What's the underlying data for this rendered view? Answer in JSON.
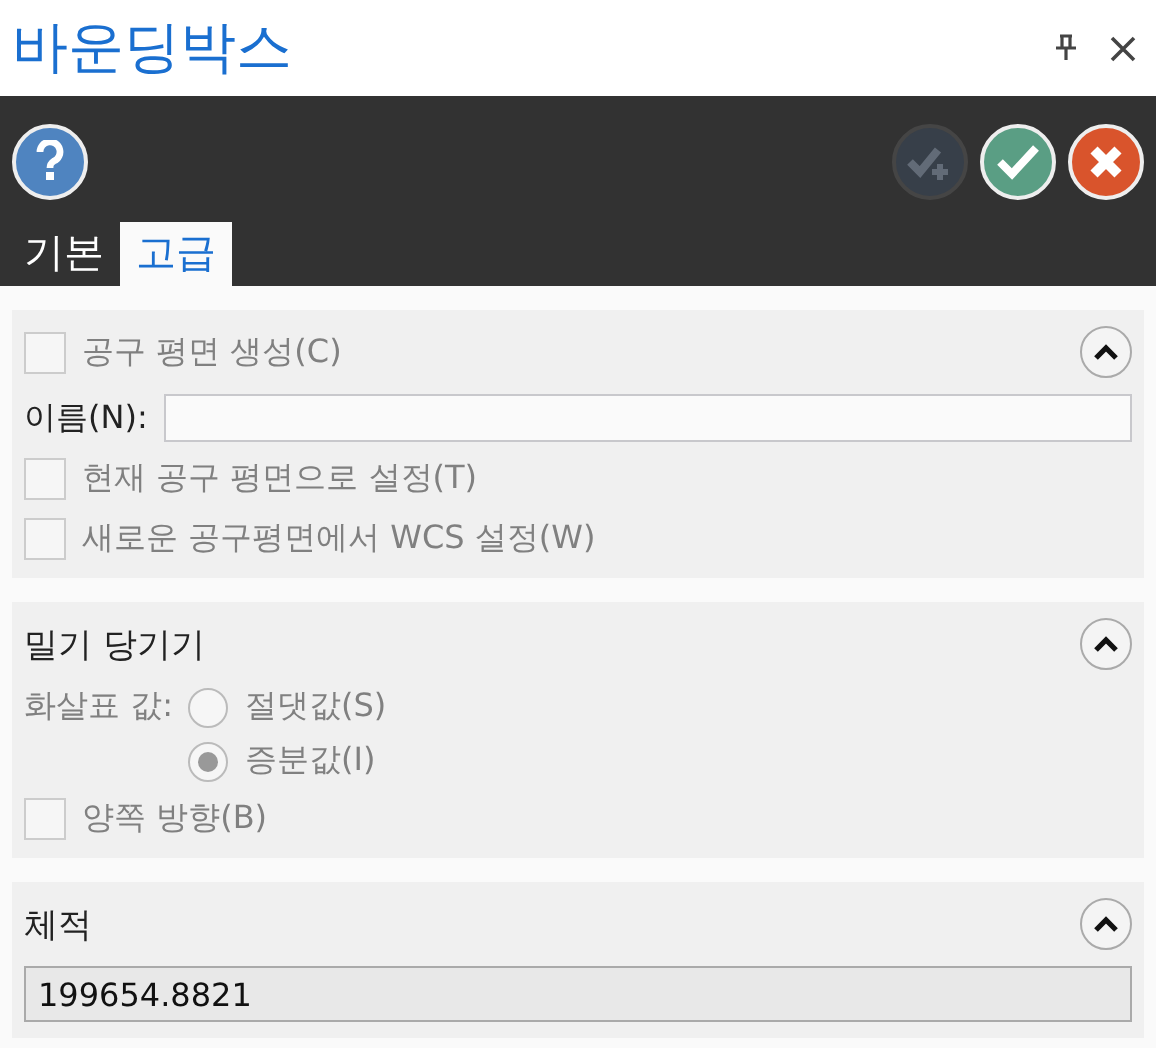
{
  "window": {
    "title": "바운딩박스"
  },
  "toolbar": {
    "buttons": [
      {
        "kind": "apply-new",
        "disabled": true
      },
      {
        "kind": "ok",
        "disabled": false
      },
      {
        "kind": "cancel",
        "disabled": false
      }
    ]
  },
  "tabs": [
    {
      "label": "기본",
      "selected": false
    },
    {
      "label": "고급",
      "selected": true
    }
  ],
  "sections": [
    {
      "kind": "checkbox-header",
      "title": "공구 평면 생성(C)",
      "checked": false,
      "disabled": true,
      "expanded": true,
      "rows": [
        {
          "kind": "text-field",
          "label": "이름(N):",
          "value": "",
          "disabled": false
        },
        {
          "kind": "checkbox",
          "label": "현재 공구 평면으로 설정(T)",
          "checked": false,
          "disabled": true
        },
        {
          "kind": "checkbox",
          "label": "새로운 공구평면에서 WCS 설정(W)",
          "checked": false,
          "disabled": true
        }
      ]
    },
    {
      "kind": "title-header",
      "title": "밀기 당기기",
      "expanded": true,
      "rows": [
        {
          "kind": "radio-group",
          "label": "화살표 값:",
          "disabled": true,
          "options": [
            {
              "label": "절댓값(S)",
              "selected": false
            },
            {
              "label": "증분값(I)",
              "selected": true
            }
          ]
        },
        {
          "kind": "checkbox",
          "label": "양쪽 방향(B)",
          "checked": false,
          "disabled": true
        }
      ]
    },
    {
      "kind": "title-header",
      "title": "체적",
      "expanded": true,
      "rows": [
        {
          "kind": "readonly-field",
          "value": "199654.8821"
        }
      ]
    }
  ]
}
